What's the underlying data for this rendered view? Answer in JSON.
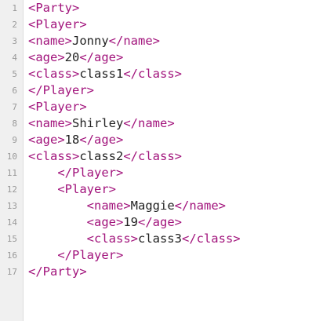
{
  "editor": {
    "lines": [
      {
        "num": "1",
        "indent": "",
        "open": "<Party>",
        "text": "",
        "close": ""
      },
      {
        "num": "2",
        "indent": "",
        "open": "<Player>",
        "text": "",
        "close": ""
      },
      {
        "num": "3",
        "indent": "",
        "open": "<name>",
        "text": "Jonny",
        "close": "</name>"
      },
      {
        "num": "4",
        "indent": "",
        "open": "<age>",
        "text": "20",
        "close": "</age>"
      },
      {
        "num": "5",
        "indent": "",
        "open": "<class>",
        "text": "class1",
        "close": "</class>"
      },
      {
        "num": "6",
        "indent": "",
        "open": "</Player>",
        "text": "",
        "close": ""
      },
      {
        "num": "7",
        "indent": "",
        "open": "<Player>",
        "text": "",
        "close": ""
      },
      {
        "num": "8",
        "indent": "",
        "open": "<name>",
        "text": "Shirley",
        "close": "</name>"
      },
      {
        "num": "9",
        "indent": "",
        "open": "<age>",
        "text": "18",
        "close": "</age>"
      },
      {
        "num": "10",
        "indent": "",
        "open": "<class>",
        "text": "class2",
        "close": "</class>"
      },
      {
        "num": "11",
        "indent": "    ",
        "open": "</Player>",
        "text": "",
        "close": ""
      },
      {
        "num": "12",
        "indent": "    ",
        "open": "<Player>",
        "text": "",
        "close": ""
      },
      {
        "num": "13",
        "indent": "        ",
        "open": "<name>",
        "text": "Maggie",
        "close": "</name>"
      },
      {
        "num": "14",
        "indent": "        ",
        "open": "<age>",
        "text": "19",
        "close": "</age>"
      },
      {
        "num": "15",
        "indent": "        ",
        "open": "<class>",
        "text": "class3",
        "close": "</class>"
      },
      {
        "num": "16",
        "indent": "    ",
        "open": "</Player>",
        "text": "",
        "close": ""
      },
      {
        "num": "17",
        "indent": "",
        "open": "</Party>",
        "text": "",
        "close": ""
      }
    ]
  },
  "colors": {
    "tag": "#a2147c",
    "text": "#222222",
    "line_number": "#999999",
    "gutter": "#f0f0f0"
  }
}
